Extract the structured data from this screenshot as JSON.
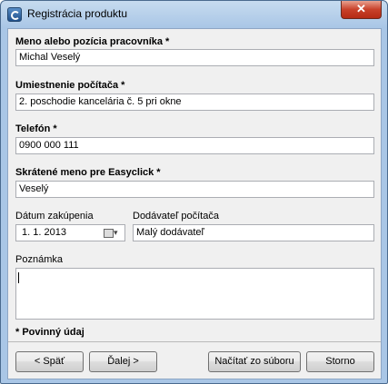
{
  "window": {
    "title": "Registrácia produktu",
    "close_glyph": "✕"
  },
  "form": {
    "name": {
      "label": "Meno alebo pozícia pracovníka *",
      "value": "Michal Veselý"
    },
    "location": {
      "label": "Umiestnenie počítača *",
      "value": "2. poschodie kancelária č. 5 pri okne"
    },
    "phone": {
      "label": "Telefón *",
      "value": "0900 000 111"
    },
    "short_name": {
      "label": "Skrátené meno pre Easyclick *",
      "value": "Veselý"
    },
    "purchase_date": {
      "label": "Dátum zakúpenia",
      "value": "1.   1. 2013"
    },
    "supplier": {
      "label": "Dodávateľ počítača",
      "value": "Malý dodávateľ"
    },
    "note": {
      "label": "Poznámka",
      "value": ""
    },
    "required_note": "* Povinný údaj"
  },
  "buttons": {
    "back": "< Späť",
    "next": "Ďalej >",
    "load": "Načítať zo súboru",
    "cancel": "Storno"
  },
  "icons": [
    "app-icon",
    "close-icon",
    "calendar-icon",
    "dropdown-arrow-icon"
  ]
}
